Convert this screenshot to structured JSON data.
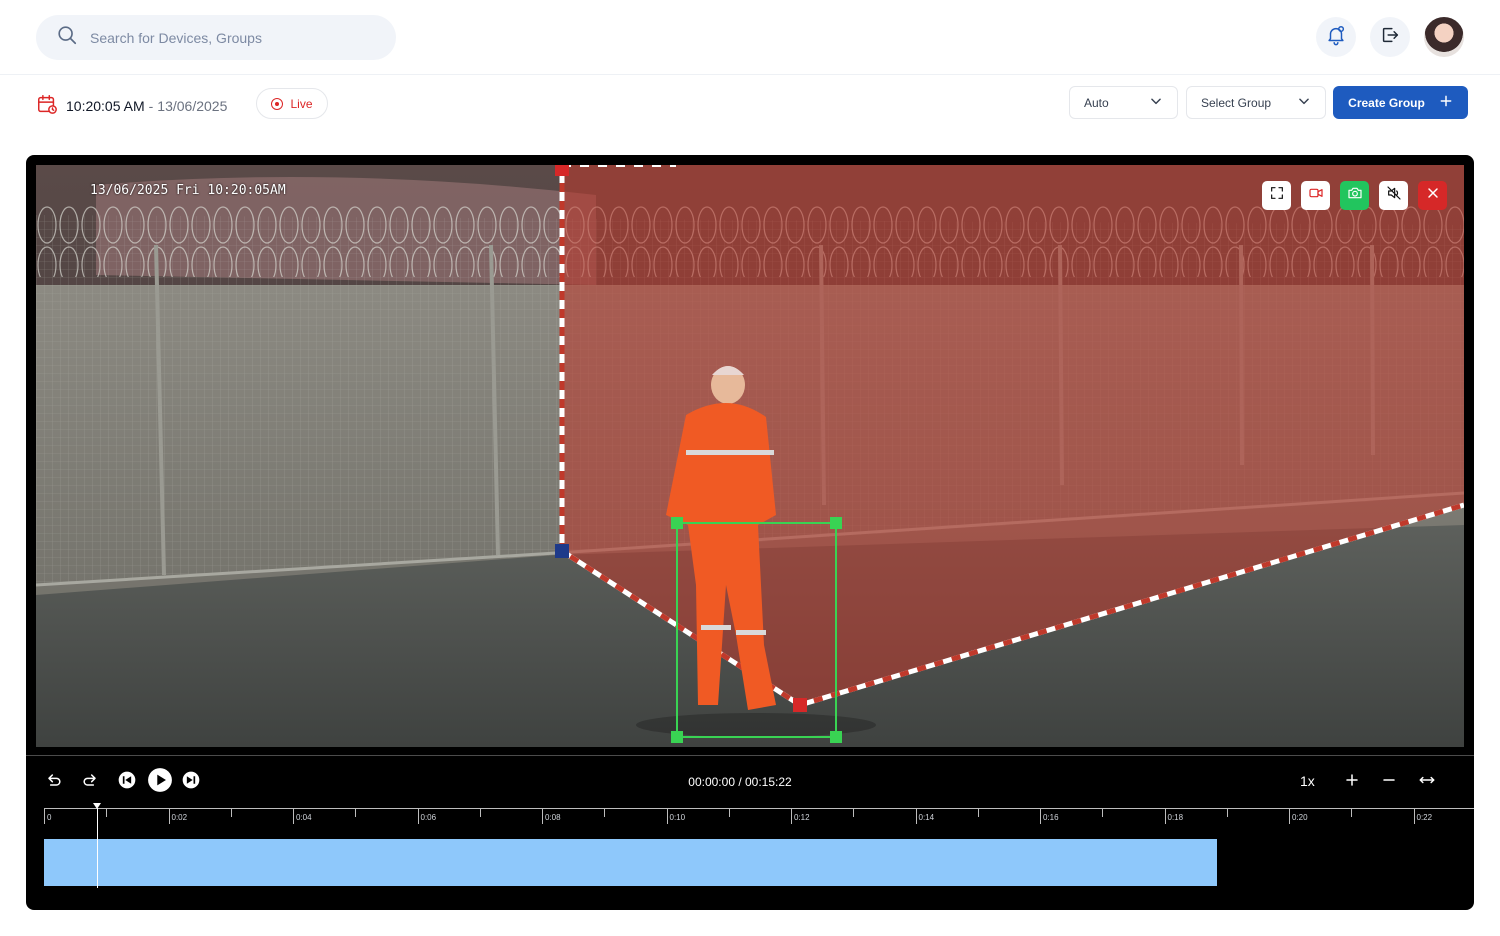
{
  "search": {
    "placeholder": "Search for Devices, Groups"
  },
  "header": {
    "time": "10:20:05 AM",
    "separator": "-",
    "date": "13/06/2025",
    "live_label": "Live",
    "mode_select": "Auto",
    "group_select": "Select Group",
    "create_label": "Create Group"
  },
  "video": {
    "osd_text": "13/06/2025 Fri 10:20:05AM",
    "zone_color": "#c0392b",
    "detection_color": "#39d353"
  },
  "player": {
    "timecode": "00:00:00 / 00:15:22",
    "speed": "1x",
    "progress_fraction": 0.82,
    "playhead_fraction": 0.037,
    "ticks": [
      "0",
      "0:02",
      "0:04",
      "0:06",
      "0:08",
      "0:10",
      "0:12",
      "0:14",
      "0:16",
      "0:18",
      "0:20",
      "0:22"
    ]
  },
  "colors": {
    "accent": "#1e5bbf",
    "live": "#dc2626",
    "timeline_bar": "#8ec8fb"
  }
}
